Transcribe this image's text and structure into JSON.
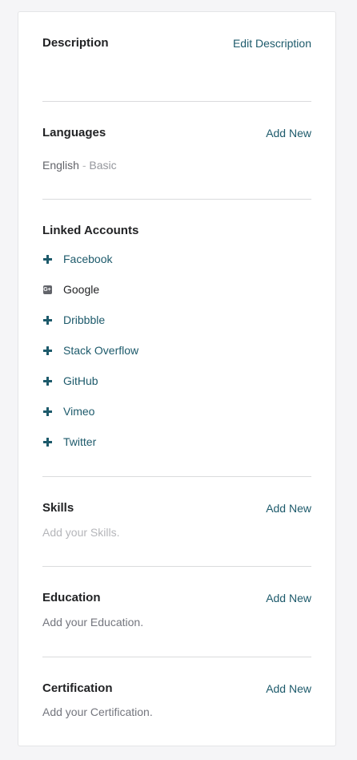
{
  "description": {
    "title": "Description",
    "action": "Edit Description"
  },
  "languages": {
    "title": "Languages",
    "action": "Add New",
    "items": [
      {
        "name": "English",
        "separator": "-",
        "level": "Basic"
      }
    ]
  },
  "linked_accounts": {
    "title": "Linked Accounts",
    "items": [
      {
        "label": "Facebook",
        "icon": "plus-icon",
        "linked": false
      },
      {
        "label": "Google",
        "icon": "google-icon",
        "linked": true
      },
      {
        "label": "Dribbble",
        "icon": "plus-icon",
        "linked": false
      },
      {
        "label": "Stack Overflow",
        "icon": "plus-icon",
        "linked": false
      },
      {
        "label": "GitHub",
        "icon": "plus-icon",
        "linked": false
      },
      {
        "label": "Vimeo",
        "icon": "plus-icon",
        "linked": false
      },
      {
        "label": "Twitter",
        "icon": "plus-icon",
        "linked": false
      }
    ]
  },
  "skills": {
    "title": "Skills",
    "action": "Add New",
    "placeholder": "Add your Skills."
  },
  "education": {
    "title": "Education",
    "action": "Add New",
    "placeholder": "Add your Education."
  },
  "certification": {
    "title": "Certification",
    "action": "Add New",
    "placeholder": "Add your Certification."
  },
  "colors": {
    "accent": "#1d5a6b",
    "heading": "#222325",
    "muted": "#b5b6ba"
  }
}
